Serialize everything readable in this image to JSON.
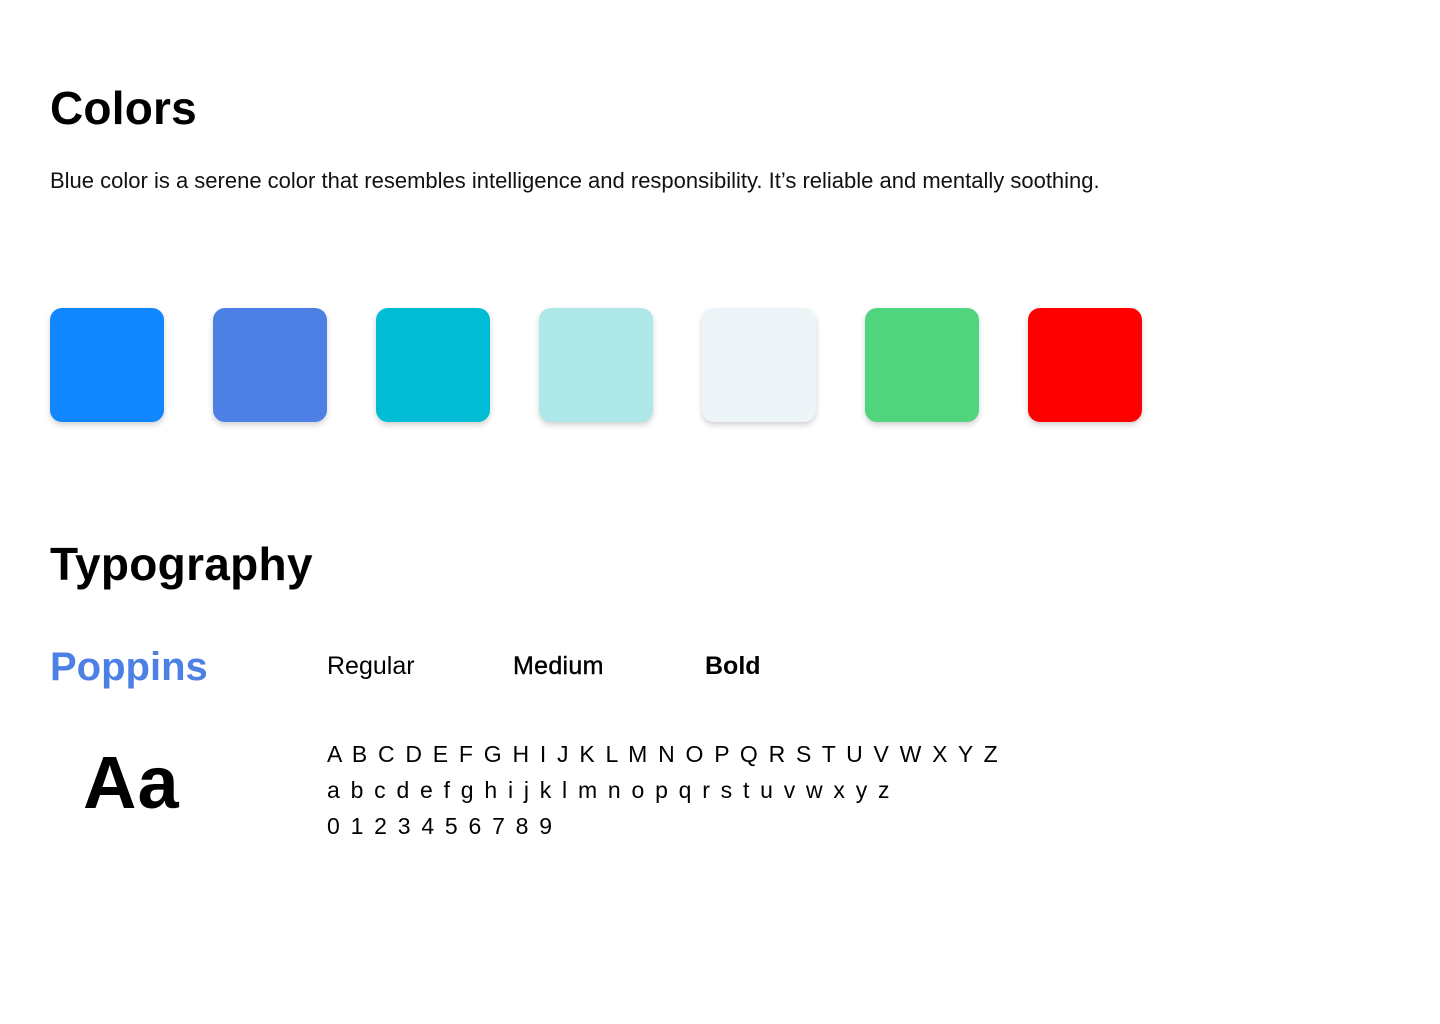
{
  "colors": {
    "heading": "Colors",
    "description": "Blue color is a serene color that resembles intelligence and responsibility. It’s reliable and mentally soothing.",
    "swatches": [
      "#1187FF",
      "#4D80E4",
      "#00BCD4",
      "#AFE8E8",
      "#EDF5F8",
      "#51D47E",
      "#FF0000"
    ]
  },
  "typography": {
    "heading": "Typography",
    "font_name": "Poppins",
    "font_name_color": "#4D80E4",
    "weights": {
      "regular": "Regular",
      "medium": "Medium",
      "bold": "Bold"
    },
    "sample": "Aa",
    "uppercase": "A B C D E F G H I J K L M N O P Q R S T U V W X Y Z",
    "lowercase": "a b c d e f g h i j k l m n o p q r s t u v w x y z",
    "digits": "0 1 2 3 4 5 6 7 8 9"
  }
}
